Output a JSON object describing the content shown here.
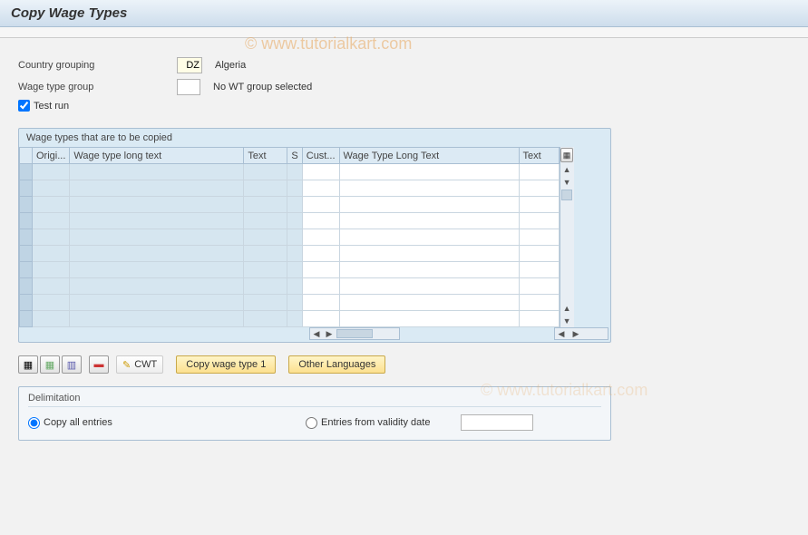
{
  "title": "Copy Wage Types",
  "watermark": "© www.tutorialkart.com",
  "fields": {
    "country_label": "Country grouping",
    "country_value": "DZ",
    "country_desc": "Algeria",
    "wtgroup_label": "Wage type group",
    "wtgroup_value": "",
    "wtgroup_desc": "No WT group selected",
    "testrun_label": "Test run",
    "testrun_checked": true
  },
  "table": {
    "title": "Wage types that are to be copied",
    "columns": {
      "origi": "Origi...",
      "wtlt": "Wage type long text",
      "text": "Text",
      "s": "S",
      "cust": "Cust...",
      "wtlt2": "Wage Type Long Text",
      "text2": "Text"
    },
    "row_count": 10
  },
  "buttons": {
    "cwt_label": "CWT",
    "copy_label": "Copy wage type 1",
    "other_lang_label": "Other Languages"
  },
  "delimitation": {
    "title": "Delimitation",
    "opt_all": "Copy all entries",
    "opt_from": "Entries from validity date",
    "selected": "all",
    "date_value": ""
  }
}
